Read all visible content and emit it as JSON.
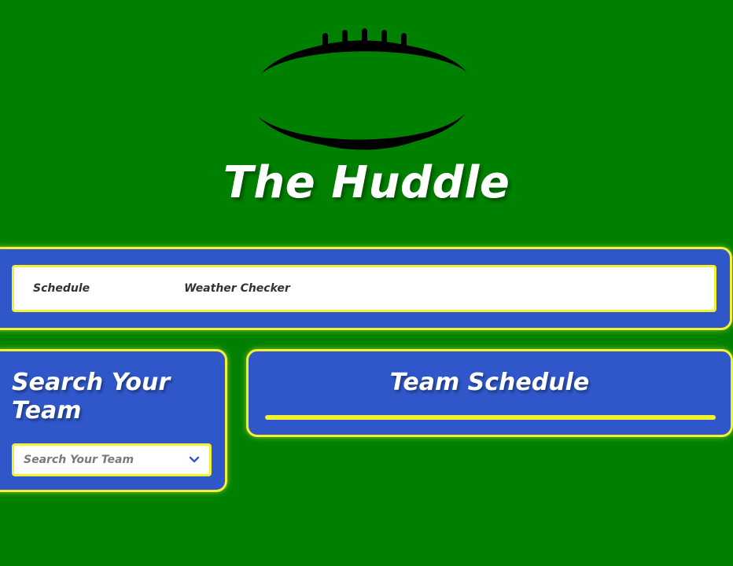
{
  "header": {
    "logo_icon": "football-laces-icon",
    "title": "The Huddle"
  },
  "nav": {
    "items": [
      {
        "label": "Schedule"
      },
      {
        "label": "Weather Checker"
      }
    ]
  },
  "search": {
    "heading": "Search Your Team",
    "select_placeholder": "Search Your Team",
    "select_icon": "chevron-down-icon"
  },
  "schedule": {
    "heading": "Team Schedule"
  },
  "colors": {
    "background": "#008000",
    "panel": "#2f57c9",
    "accent": "#f4f230",
    "text_light": "#ffffff"
  }
}
